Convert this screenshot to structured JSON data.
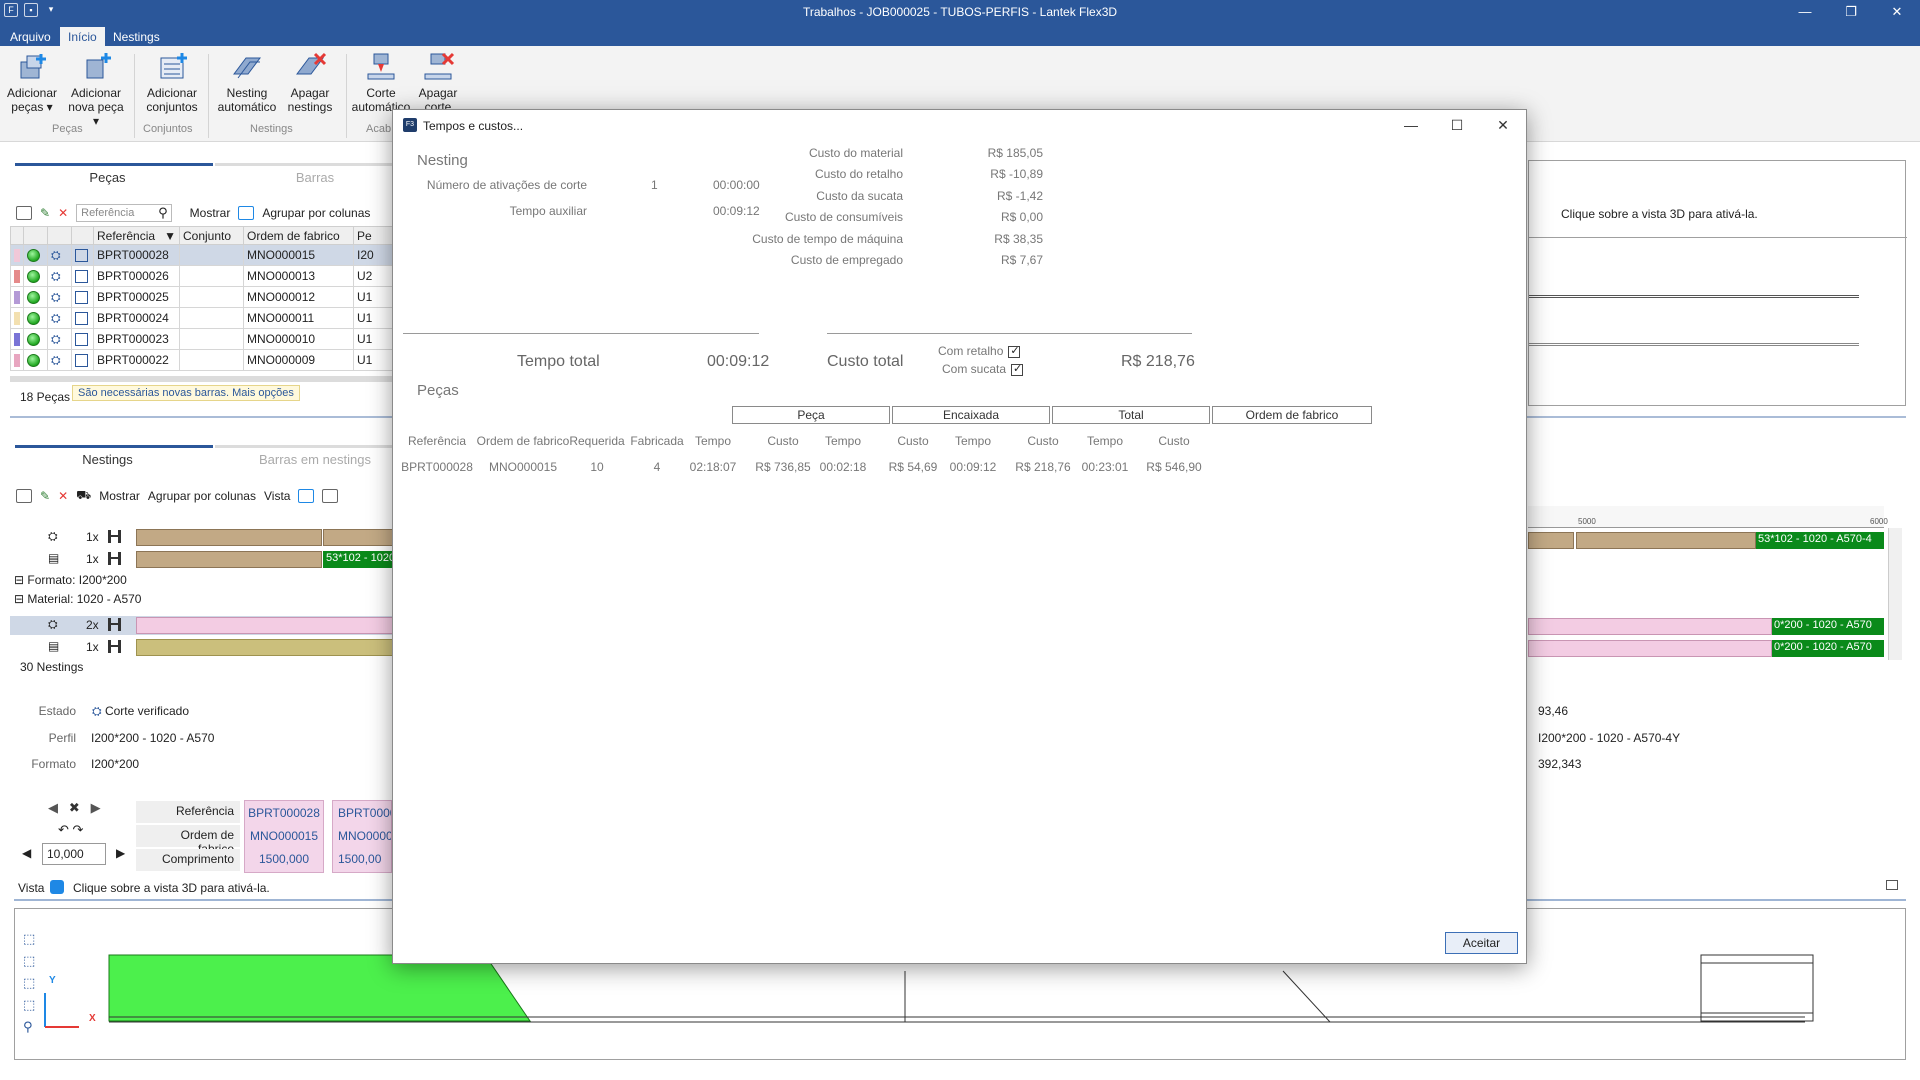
{
  "window": {
    "title": "Trabalhos - JOB000025 - TUBOS-PERFIS - Lantek Flex3D",
    "app_icon": "lantek-flex3d-icon",
    "qa_icons": [
      "app-icon",
      "save-icon",
      "chevron-down-icon"
    ]
  },
  "menu": {
    "tabs": [
      "Arquivo",
      "Início",
      "Nestings"
    ],
    "active": "Início"
  },
  "ribbon": {
    "buttons": [
      {
        "label1": "Adicionar",
        "label2": "peças ▾"
      },
      {
        "label1": "Adicionar",
        "label2": "nova peça ▾"
      },
      {
        "label1": "Adicionar",
        "label2": "conjuntos"
      },
      {
        "label1": "Nesting",
        "label2": "automático"
      },
      {
        "label1": "Apagar",
        "label2": "nestings"
      },
      {
        "label1": "Corte",
        "label2": "automático"
      },
      {
        "label1": "Apagar",
        "label2": "corte"
      }
    ],
    "groups": [
      "Peças",
      "Conjuntos",
      "Nestings",
      "Acab"
    ]
  },
  "pieces_panel": {
    "tabs": [
      "Peças",
      "Barras"
    ],
    "search_placeholder": "Referência",
    "show_label": "Mostrar",
    "group_label": "Agrupar por colunas",
    "columns": [
      "Referência",
      "Conjunto",
      "Ordem de fabrico",
      "Pe"
    ],
    "rows": [
      {
        "ref": "BPRT000028",
        "set": "",
        "order": "MNO000015",
        "pe": "I20",
        "color": "#f1c8d8"
      },
      {
        "ref": "BPRT000026",
        "set": "",
        "order": "MNO000013",
        "pe": "U2",
        "color": "#e58a8a"
      },
      {
        "ref": "BPRT000025",
        "set": "",
        "order": "MNO000012",
        "pe": "U1",
        "color": "#b49ad6"
      },
      {
        "ref": "BPRT000024",
        "set": "",
        "order": "MNO000011",
        "pe": "U1",
        "color": "#f3e0b0"
      },
      {
        "ref": "BPRT000023",
        "set": "",
        "order": "MNO000010",
        "pe": "U1",
        "color": "#7a74d6"
      },
      {
        "ref": "BPRT000022",
        "set": "",
        "order": "MNO000009",
        "pe": "U1",
        "color": "#e8a6c0"
      }
    ],
    "count_label": "18 Peças",
    "hint_text": "São necessárias novas barras.",
    "hint_link": "Mais opções"
  },
  "nestings_panel": {
    "tabs": [
      "Nestings",
      "Barras em nestings"
    ],
    "show_label": "Mostrar",
    "group_label": "Agrupar por colunas",
    "view_label": "Vista",
    "rows": [
      {
        "qty": "1x",
        "label": ""
      },
      {
        "qty": "1x",
        "label": "53*102 - 1020"
      }
    ],
    "format_group": "Formato: I200*200",
    "material_group": "Material: 1020 - A570",
    "rows2": [
      {
        "qty": "2x"
      },
      {
        "qty": "1x"
      }
    ],
    "count_label": "30 Nestings",
    "right_labels": [
      "53*102 - 1020 - A570-4",
      "0*200 - 1020 - A570",
      "0*200 - 1020 - A570"
    ],
    "ruler": [
      "5000",
      "6000"
    ]
  },
  "properties": {
    "estado_label": "Estado",
    "estado_value": "Corte verificado",
    "perfil_label": "Perfil",
    "perfil_value": "I200*200 - 1020 - A570",
    "formato_label": "Formato",
    "formato_value": "I200*200",
    "right_values": [
      "93,46",
      "I200*200 - 1020 - A570-4Y",
      "392,343"
    ]
  },
  "bar_detail": {
    "labels": [
      "Referência",
      "Ordem de fabrico",
      "Comprimento"
    ],
    "cells": [
      {
        "ref": "BPRT000028",
        "order": "MNO000015",
        "length": "1500,000"
      },
      {
        "ref": "BPRT0000",
        "order": "MNO0000",
        "length": "1500,00"
      }
    ],
    "step_value": "10,000"
  },
  "view": {
    "label": "Vista",
    "hint": "Clique sobre a vista 3D para ativá-la.",
    "top_hint": "Clique sobre a vista 3D para ativá-la.",
    "axis_x": "X",
    "axis_y": "Y"
  },
  "dialog": {
    "title": "Tempos e custos...",
    "nesting_title": "Nesting",
    "left_rows": [
      {
        "label": "Número de ativações de corte",
        "value1": "1",
        "value2": "00:00:00"
      },
      {
        "label": "Tempo auxiliar",
        "value1": "",
        "value2": "00:09:12"
      }
    ],
    "cost_rows": [
      {
        "label": "Custo do material",
        "value": "R$ 185,05"
      },
      {
        "label": "Custo do retalho",
        "value": "R$ -10,89"
      },
      {
        "label": "Custo da sucata",
        "value": "R$ -1,42"
      },
      {
        "label": "Custo de consumíveis",
        "value": "R$ 0,00"
      },
      {
        "label": "Custo de tempo de máquina",
        "value": "R$ 38,35"
      },
      {
        "label": "Custo de empregado",
        "value": "R$ 7,67"
      }
    ],
    "total_time_label": "Tempo total",
    "total_time_value": "00:09:12",
    "total_cost_label": "Custo total",
    "total_cost_value": "R$ 218,76",
    "with_remnant": "Com retalho",
    "with_scrap": "Com sucata",
    "pieces_title": "Peças",
    "group_headers": [
      "Peça",
      "Encaixada",
      "Total",
      "Ordem de fabrico"
    ],
    "columns": [
      "Referência",
      "Ordem de fabrico",
      "Requerida",
      "Fabricada",
      "Tempo",
      "Custo",
      "Tempo",
      "Custo",
      "Tempo",
      "Custo",
      "Tempo",
      "Custo"
    ],
    "rows": [
      [
        "BPRT000028",
        "MNO000015",
        "10",
        "4",
        "02:18:07",
        "R$ 736,85",
        "00:02:18",
        "R$ 54,69",
        "00:09:12",
        "R$ 218,76",
        "00:23:01",
        "R$ 546,90"
      ]
    ],
    "accept_label": "Aceitar"
  }
}
